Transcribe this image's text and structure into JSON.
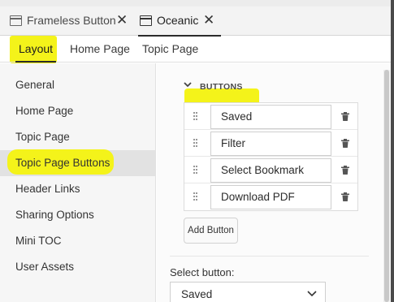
{
  "doc_tabs": [
    {
      "label": "Frameless Button",
      "close": "✕",
      "icon": "window-icon"
    },
    {
      "label": "Oceanic",
      "close": "✕",
      "icon": "window-icon",
      "active": true
    }
  ],
  "sub_tabs": [
    {
      "label": "Layout",
      "active": true
    },
    {
      "label": "Home Page"
    },
    {
      "label": "Topic Page"
    }
  ],
  "nav": {
    "items": [
      {
        "label": "General"
      },
      {
        "label": "Home Page"
      },
      {
        "label": "Topic Page"
      },
      {
        "label": "Topic Page Buttons",
        "selected": true
      },
      {
        "label": "Header Links"
      },
      {
        "label": "Sharing Options"
      },
      {
        "label": "Mini TOC"
      },
      {
        "label": "User Assets"
      }
    ]
  },
  "section": {
    "title": "BUTTONS",
    "expanded": true,
    "buttons": [
      {
        "label": "Saved"
      },
      {
        "label": "Filter"
      },
      {
        "label": "Select Bookmark"
      },
      {
        "label": "Download PDF"
      }
    ],
    "add_label": "Add Button"
  },
  "select_button": {
    "label": "Select button:",
    "value": "Saved"
  },
  "colors": {
    "highlight": "#f4f31a",
    "selected_nav_bg": "#e2e2e2"
  }
}
